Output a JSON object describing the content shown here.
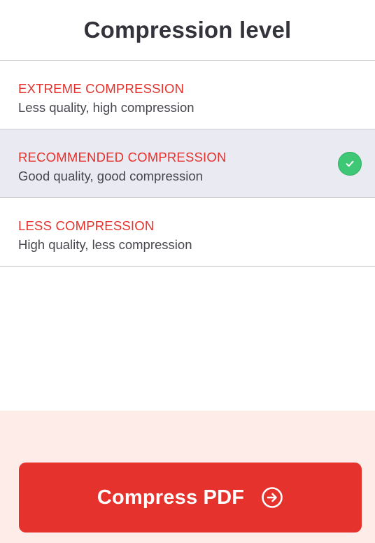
{
  "header": {
    "title": "Compression level"
  },
  "options": [
    {
      "title": "EXTREME COMPRESSION",
      "description": "Less quality, high compression",
      "selected": false
    },
    {
      "title": "RECOMMENDED COMPRESSION",
      "description": "Good quality, good compression",
      "selected": true
    },
    {
      "title": "LESS COMPRESSION",
      "description": "High quality, less compression",
      "selected": false
    }
  ],
  "footer": {
    "button_label": "Compress PDF",
    "button_icon": "arrow-right-circle-icon"
  },
  "colors": {
    "accent": "#e5322d",
    "selected_background": "#e9eaf2",
    "check": "#3ec775",
    "footer_background": "#fdece8"
  }
}
